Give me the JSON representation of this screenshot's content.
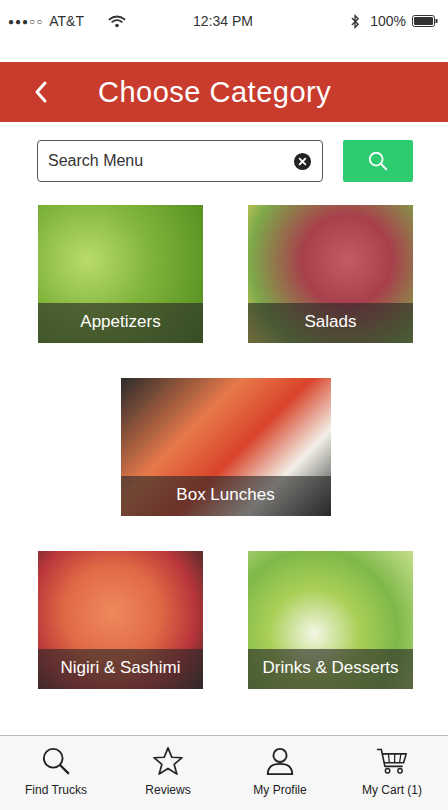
{
  "status_bar": {
    "signal": "●●●○○",
    "carrier": "AT&T",
    "time": "12:34 PM",
    "battery": "100%"
  },
  "header": {
    "title": "Choose Category"
  },
  "search": {
    "placeholder": "Search Menu"
  },
  "categories": [
    {
      "label": "Appetizers"
    },
    {
      "label": "Salads"
    },
    {
      "label": "Box Lunches"
    },
    {
      "label": "Nigiri & Sashimi"
    },
    {
      "label": "Drinks & Desserts"
    }
  ],
  "tabs": [
    {
      "label": "Find Trucks",
      "selected": false
    },
    {
      "label": "Reviews",
      "selected": false
    },
    {
      "label": "My Profile",
      "selected": false
    },
    {
      "label": "My Cart (1)",
      "selected": false
    }
  ]
}
